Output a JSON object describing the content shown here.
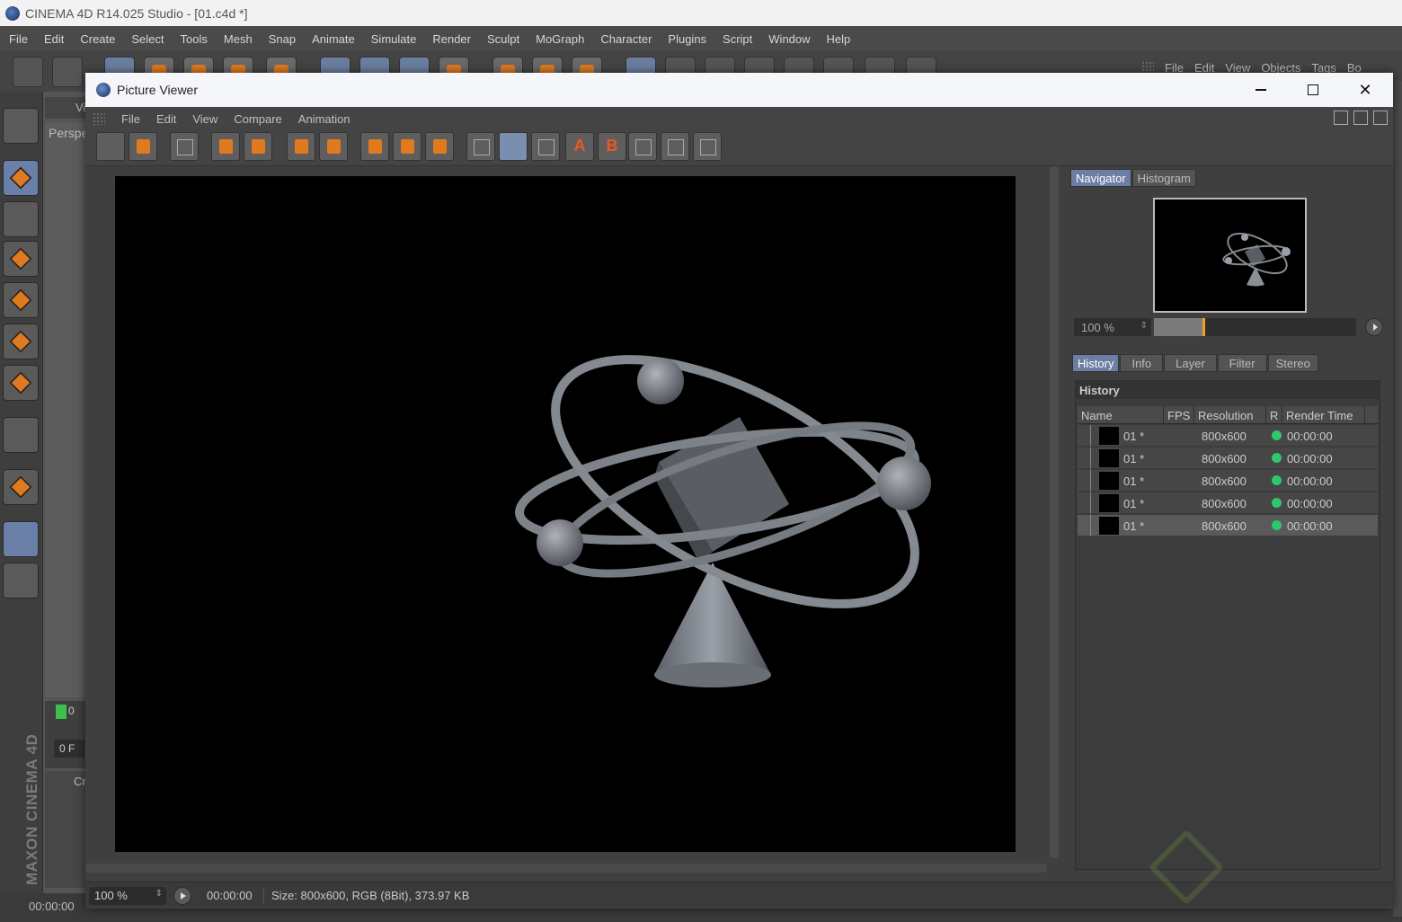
{
  "app": {
    "title": "CINEMA 4D R14.025 Studio - [01.c4d *]",
    "menu": [
      "File",
      "Edit",
      "Create",
      "Select",
      "Tools",
      "Mesh",
      "Snap",
      "Animate",
      "Simulate",
      "Render",
      "Sculpt",
      "MoGraph",
      "Character",
      "Plugins",
      "Script",
      "Window",
      "Help"
    ],
    "object_manager_menu": [
      "File",
      "Edit",
      "View",
      "Objects",
      "Tags",
      "Bo"
    ],
    "viewport_label": "Perspe",
    "viewport_menu_initial": "Vi",
    "timeline_start": "0",
    "frame_field": "0 F",
    "lower_panel_label": "Cr",
    "brand_text": "MAXON CINEMA 4D",
    "bottom_time": "00:00:00"
  },
  "picture_viewer": {
    "title": "Picture Viewer",
    "menu": [
      "File",
      "Edit",
      "View",
      "Compare",
      "Animation"
    ],
    "toolbar_letters": {
      "a": "A",
      "b": "B"
    },
    "status": {
      "zoom": "100 %",
      "time": "00:00:00",
      "size": "Size: 800x600, RGB (8Bit), 373.97 KB"
    },
    "navigator": {
      "tabs": [
        "Navigator",
        "Histogram"
      ],
      "active_tab": "Navigator",
      "zoom": "100 %",
      "zoom_level_fraction": 0.25
    },
    "history": {
      "tabs": [
        "History",
        "Info",
        "Layer",
        "Filter",
        "Stereo"
      ],
      "active_tab": "History",
      "heading": "History",
      "columns": [
        "Name",
        "FPS",
        "Resolution",
        "R",
        "Render Time"
      ],
      "rows": [
        {
          "name": "01 *",
          "resolution": "800x600",
          "render_time": "00:00:00",
          "status_color": "#2ec86a"
        },
        {
          "name": "01 *",
          "resolution": "800x600",
          "render_time": "00:00:00",
          "status_color": "#2ec86a"
        },
        {
          "name": "01 *",
          "resolution": "800x600",
          "render_time": "00:00:00",
          "status_color": "#2ec86a"
        },
        {
          "name": "01 *",
          "resolution": "800x600",
          "render_time": "00:00:00",
          "status_color": "#2ec86a"
        },
        {
          "name": "01 *",
          "resolution": "800x600",
          "render_time": "00:00:00",
          "status_color": "#2ec86a"
        }
      ],
      "selected_row": 4
    }
  },
  "colors": {
    "accent_orange": "#e07a20",
    "tab_active": "#6c7ea3",
    "render_background": "#000000"
  }
}
